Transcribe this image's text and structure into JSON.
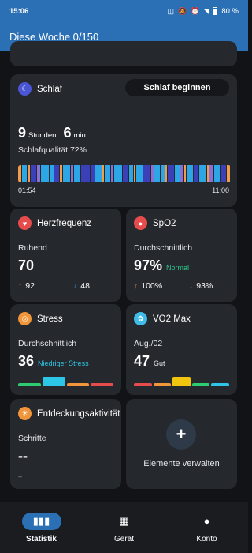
{
  "status_bar": {
    "time": "15:06",
    "battery": "80 %",
    "icons": [
      "nfc-icon",
      "mute-icon",
      "alarm-icon",
      "wifi-icon",
      "battery-icon"
    ]
  },
  "header": {
    "title": "Diese Woche 0/150"
  },
  "sleep": {
    "title": "Schlaf",
    "icon": "moon-icon",
    "button_label": "Schlaf beginnen",
    "hours": "9",
    "hours_unit": "Stunden",
    "minutes": "6",
    "minutes_unit": "min",
    "quality": "Schlafqualität 72%",
    "start_time": "01:54",
    "end_time": "11:00",
    "stage_colors": {
      "awake": "#f39c4a",
      "light": "#2da6e6",
      "deep": "#3b3fb8",
      "rem": "#8a6fd6"
    }
  },
  "heart_rate": {
    "title": "Herzfrequenz",
    "icon": "heart-icon",
    "label": "Ruhend",
    "value": "70",
    "max": "92",
    "min": "48",
    "accent": "#e74c4c"
  },
  "spo2": {
    "title": "SpO2",
    "icon": "drop-icon",
    "label": "Durchschnittlich",
    "value": "97%",
    "status": "Normal",
    "max": "100%",
    "min": "93%",
    "accent": "#e74c4c",
    "status_color": "#2ec98b"
  },
  "stress": {
    "title": "Stress",
    "icon": "stress-icon",
    "label": "Durchschnittlich",
    "value": "36",
    "status": "Niedriger Stress",
    "status_color": "#2ec6e6",
    "accent": "#f0953a",
    "levels": [
      "#2ecc71",
      "#2ec6e6",
      "#f0953a",
      "#e74c4c"
    ],
    "active_level": 1
  },
  "vo2max": {
    "title": "VO2 Max",
    "icon": "vo2-icon",
    "label": "Aug./02",
    "value": "47",
    "status": "Gut",
    "accent": "#3fbde8",
    "levels": [
      "#e74c4c",
      "#f0953a",
      "#f1c40f",
      "#2ecc71",
      "#2ec6e6"
    ],
    "active_level": 2
  },
  "discovery": {
    "title": "Entdeckungsaktivität",
    "icon": "sun-icon",
    "label": "Schritte",
    "value": "--",
    "sub": "--",
    "accent": "#f0953a"
  },
  "manage": {
    "label": "Elemente verwalten",
    "icon": "plus-icon"
  },
  "bottom_nav": [
    {
      "label": "Statistik",
      "icon": "chart-icon",
      "active": true
    },
    {
      "label": "Gerät",
      "icon": "grid-icon",
      "active": false
    },
    {
      "label": "Konto",
      "icon": "person-icon",
      "active": false
    }
  ]
}
